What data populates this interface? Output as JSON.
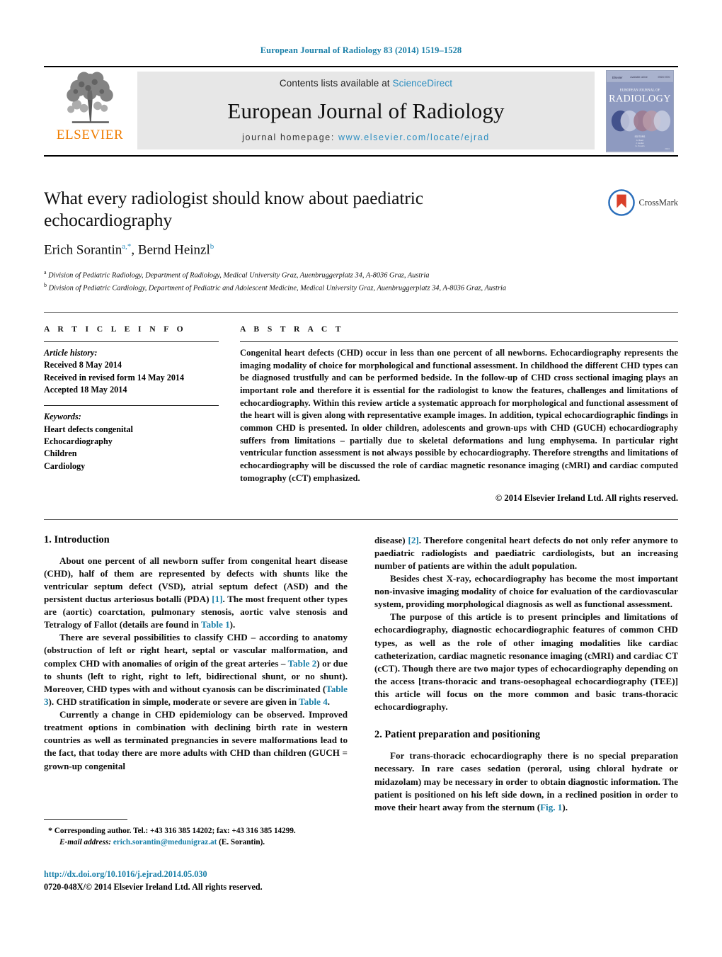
{
  "running_head": "European Journal of Radiology 83 (2014) 1519–1528",
  "masthead": {
    "publisher_name": "ELSEVIER",
    "contents_prefix": "Contents lists available at",
    "contents_link": "ScienceDirect",
    "journal_title": "European Journal of Radiology",
    "homepage_prefix": "journal homepage:",
    "homepage_url": "www.elsevier.com/locate/ejrad",
    "cover_title": "RADIOLOGY",
    "cover_supertitle": "EUROPEAN JOURNAL OF",
    "link_color": "#2c8ec0",
    "elsevier_orange": "#f07d00"
  },
  "article": {
    "title": "What every radiologist should know about paediatric echocardiography",
    "authors_plain": "Erich Sorantin",
    "author1": "Erich Sorantin",
    "author1_sup": "a,*",
    "author2": "Bernd Heinzl",
    "author2_sup": "b",
    "crossmark_label": "CrossMark",
    "affiliation_a_sup": "a",
    "affiliation_a": "Division of Pediatric Radiology, Department of Radiology, Medical University Graz, Auenbruggerplatz 34, A-8036 Graz, Austria",
    "affiliation_b_sup": "b",
    "affiliation_b": "Division of Pediatric Cardiology, Department of Pediatric and Adolescent Medicine, Medical University Graz, Auenbruggerplatz 34, A-8036 Graz, Austria"
  },
  "article_info": {
    "heading": "A R T I C L E   I N F O",
    "history_label": "Article history:",
    "history": [
      "Received 8 May 2014",
      "Received in revised form 14 May 2014",
      "Accepted 18 May 2014"
    ],
    "keywords_label": "Keywords:",
    "keywords": [
      "Heart defects congenital",
      "Echocardiography",
      "Children",
      "Cardiology"
    ]
  },
  "abstract": {
    "heading": "A B S T R A C T",
    "text": "Congenital heart defects (CHD) occur in less than one percent of all newborns. Echocardiography represents the imaging modality of choice for morphological and functional assessment. In childhood the different CHD types can be diagnosed trustfully and can be performed bedside. In the follow-up of CHD cross sectional imaging plays an important role and therefore it is essential for the radiologist to know the features, challenges and limitations of echocardiography. Within this review article a systematic approach for morphological and functional assessment of the heart will is given along with representative example images. In addition, typical echocardiographic findings in common CHD is presented. In older children, adolescents and grown-ups with CHD (GUCH) echocardiography suffers from limitations – partially due to skeletal deformations and lung emphysema. In particular right ventricular function assessment is not always possible by echocardiography. Therefore strengths and limitations of echocardiography will be discussed the role of cardiac magnetic resonance imaging (cMRI) and cardiac computed tomography (cCT) emphasized.",
    "copyright": "© 2014 Elsevier Ireland Ltd. All rights reserved."
  },
  "body": {
    "section1_heading": "1.  Introduction",
    "section1_p1_a": "About one percent of all newborn suffer from congenital heart disease (CHD), half of them are represented by defects with shunts like the ventricular septum defect (VSD), atrial septum defect (ASD) and the persistent ductus arteriosus botalli (PDA) ",
    "section1_p1_ref1": "[1]",
    "section1_p1_b": ". The most frequent other types are (aortic) coarctation, pulmonary stenosis, aortic valve stenosis and Tetralogy of Fallot (details are found in ",
    "section1_p1_table1": "Table 1",
    "section1_p1_c": ").",
    "section1_p2_a": "There are several possibilities to classify CHD – according to anatomy (obstruction of left or right heart, septal or vascular malformation, and complex CHD with anomalies of origin of the great arteries – ",
    "section1_p2_table2": "Table 2",
    "section1_p2_b": ") or due to shunts (left to right, right to left, bidirectional shunt, or no shunt). Moreover, CHD types with and without cyanosis can be discriminated (",
    "section1_p2_table3": "Table 3",
    "section1_p2_c": "). CHD stratification in simple, moderate or severe are given in ",
    "section1_p2_table4": "Table 4",
    "section1_p2_d": ".",
    "section1_p3": "Currently a change in CHD epidemiology can be observed. Improved treatment options in combination with declining birth rate in western countries as well as terminated pregnancies in severe malformations lead to the fact, that today there are more adults with CHD than children (GUCH = grown-up congenital",
    "section1_p3_cont_a": "disease) ",
    "section1_p3_cont_ref2": "[2]",
    "section1_p3_cont_b": ". Therefore congenital heart defects do not only refer anymore to paediatric radiologists and paediatric cardiologists, but an increasing number of patients are within the adult population.",
    "section1_p4": "Besides chest X-ray, echocardiography has become the most important non-invasive imaging modality of choice for evaluation of the cardiovascular system, providing morphological diagnosis as well as functional assessment.",
    "section1_p5": "The purpose of this article is to present principles and limitations of echocardiography, diagnostic echocardiographic features of common CHD types, as well as the role of other imaging modalities like cardiac catheterization, cardiac magnetic resonance imaging (cMRI) and cardiac CT (cCT). Though there are two major types of echocardiography depending on the access [trans-thoracic and trans-oesophageal echocardiography (TEE)] this article will focus on the more common and basic trans-thoracic echocardiography.",
    "section2_heading": "2.  Patient preparation and positioning",
    "section2_p1_a": "For trans-thoracic echocardiography there is no special preparation necessary. In rare cases sedation (peroral, using chloral hydrate or midazolam) may be necessary in order to obtain diagnostic information. The patient is positioned on his left side down, in a reclined position in order to move their heart away from the sternum (",
    "section2_p1_fig1": "Fig. 1",
    "section2_p1_b": ")."
  },
  "footer": {
    "corresponding_star": "*",
    "corresponding_text": "Corresponding author. Tel.: +43 316 385 14202; fax: +43 316 385 14299.",
    "email_label": "E-mail address:",
    "email": "erich.sorantin@medunigraz.at",
    "email_suffix": "(E. Sorantin).",
    "doi": "http://dx.doi.org/10.1016/j.ejrad.2014.05.030",
    "issn_line": "0720-048X/© 2014 Elsevier Ireland Ltd. All rights reserved."
  }
}
